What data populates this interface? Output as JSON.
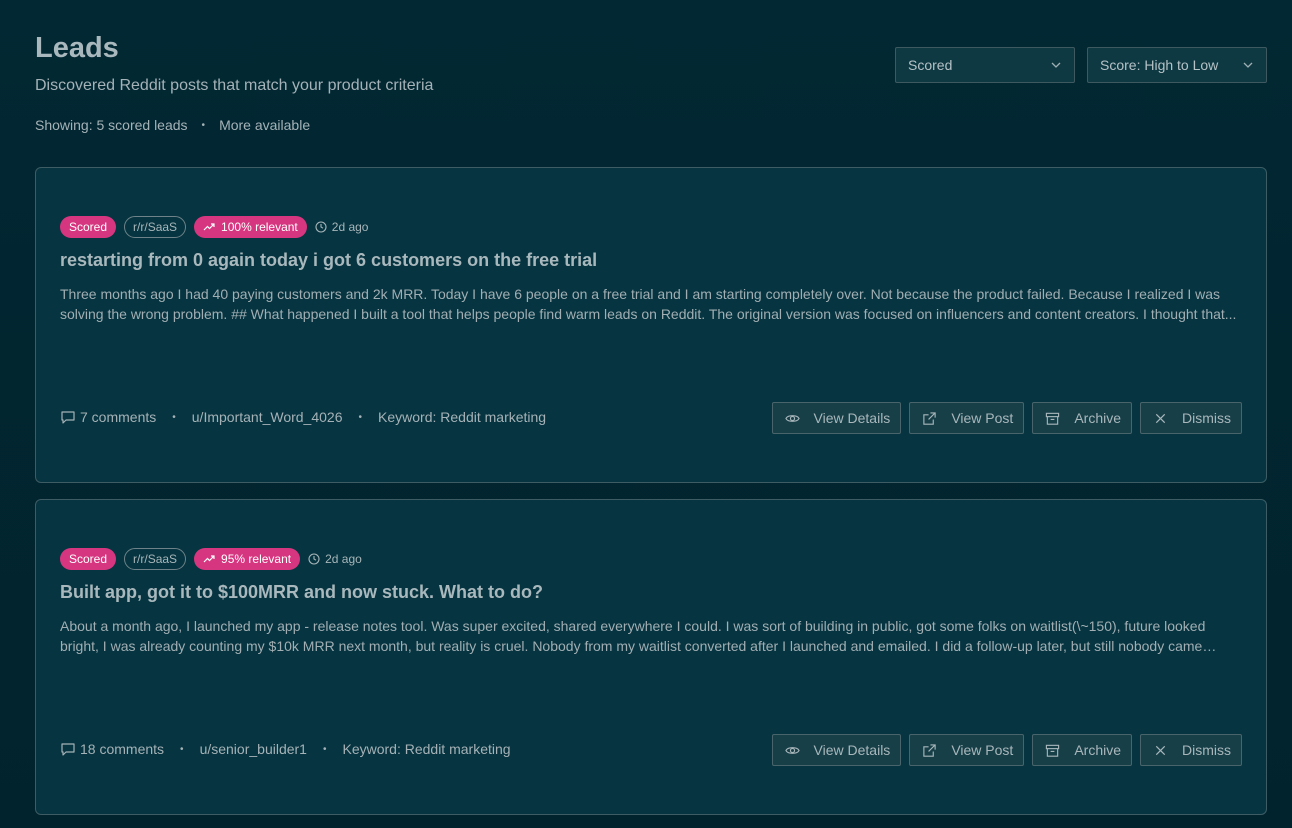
{
  "header": {
    "title": "Leads",
    "subtitle": "Discovered Reddit posts that match your product criteria",
    "showing": "Showing: 5 scored leads",
    "more": "More available"
  },
  "filters": {
    "status": "Scored",
    "sort": "Score: High to Low"
  },
  "leads": [
    {
      "status": "Scored",
      "subreddit": "r/r/SaaS",
      "relevance": "100% relevant",
      "age": "2d ago",
      "title": "restarting from 0 again today i got 6 customers on the free trial",
      "excerpt": "Three months ago I had 40 paying customers and 2k MRR. Today I have 6 people on a free trial and I am starting completely over. Not because the product failed. Because I realized I was solving the wrong problem. ## What happened I built a tool that helps people find warm leads on Reddit. The original version was focused on influencers and content creators. I thought that...",
      "comments": "7 comments",
      "author": "u/Important_Word_4026",
      "keyword": "Keyword: Reddit marketing"
    },
    {
      "status": "Scored",
      "subreddit": "r/r/SaaS",
      "relevance": "95% relevant",
      "age": "2d ago",
      "title": "Built app, got it to $100MRR and now stuck. What to do?",
      "excerpt": "About a month ago, I launched my app - release notes tool. Was super excited, shared everywhere I could. I was sort of building in public, got some folks on waitlist(\\~150), future looked bright, I was already counting my $10k MRR next month, but reality is cruel. Nobody from my waitlist converted after I launched and emailed. I did a follow-up later, but still nobody came back...",
      "comments": "18 comments",
      "author": "u/senior_builder1",
      "keyword": "Keyword: Reddit marketing"
    }
  ],
  "actions": {
    "view_details": "View Details",
    "view_post": "View Post",
    "archive": "Archive",
    "dismiss": "Dismiss"
  },
  "icons": {
    "comment": "comment-icon",
    "eye": "eye-icon",
    "external": "external-link-icon",
    "archive": "archive-icon",
    "close": "close-icon",
    "clock": "clock-icon",
    "trend": "trending-up-icon",
    "chevron": "chevron-down-icon"
  },
  "colors": {
    "badge_pink": "#d6367f",
    "background": "#022833",
    "card": "#063440"
  }
}
